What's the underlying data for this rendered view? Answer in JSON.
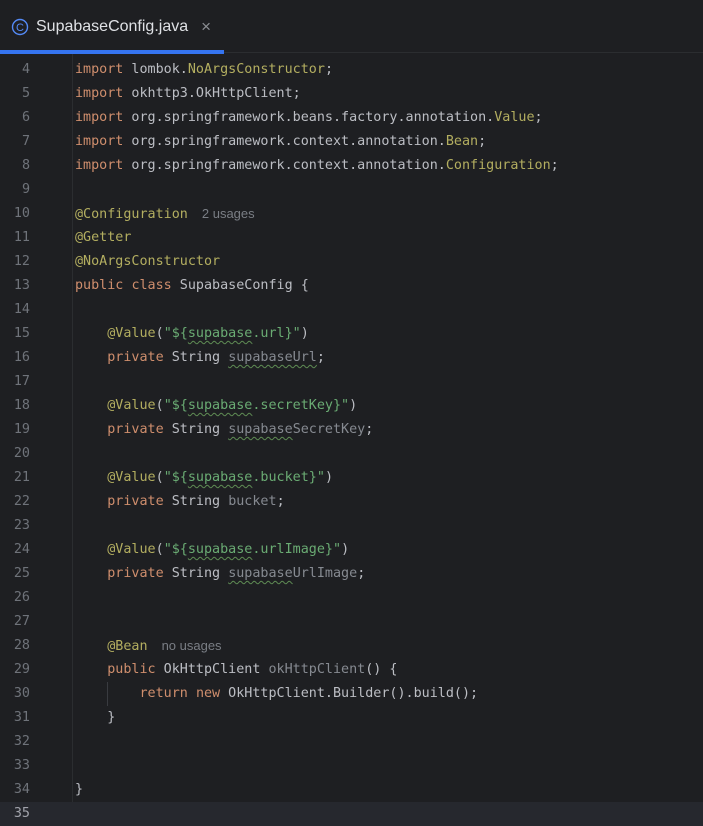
{
  "tab": {
    "filename": "SupabaseConfig.java",
    "close": "×",
    "icon": "java-class-icon",
    "icon_letter": "C"
  },
  "colors": {
    "background": "#1e1f22",
    "keyword": "#cf8e6d",
    "annotation": "#b3ae60",
    "string": "#6aab73",
    "text": "#bcbec4",
    "accent": "#3574f0"
  },
  "lines": [
    {
      "n": "4",
      "t": [
        {
          "x": "import",
          "c": "kw"
        },
        {
          "x": " lombok."
        },
        {
          "x": "NoArgsConstructor",
          "c": "yl"
        },
        {
          "x": ";"
        }
      ]
    },
    {
      "n": "5",
      "t": [
        {
          "x": "import",
          "c": "kw"
        },
        {
          "x": " okhttp3.OkHttpClient;"
        }
      ]
    },
    {
      "n": "6",
      "t": [
        {
          "x": "import",
          "c": "kw"
        },
        {
          "x": " org.springframework.beans.factory.annotation."
        },
        {
          "x": "Value",
          "c": "yl"
        },
        {
          "x": ";"
        }
      ]
    },
    {
      "n": "7",
      "t": [
        {
          "x": "import",
          "c": "kw"
        },
        {
          "x": " org.springframework.context.annotation."
        },
        {
          "x": "Bean",
          "c": "yl"
        },
        {
          "x": ";"
        }
      ]
    },
    {
      "n": "8",
      "t": [
        {
          "x": "import",
          "c": "kw"
        },
        {
          "x": " org.springframework.context.annotation."
        },
        {
          "x": "Configuration",
          "c": "yl"
        },
        {
          "x": ";"
        }
      ]
    },
    {
      "n": "9",
      "t": []
    },
    {
      "n": "10",
      "t": [
        {
          "x": "@Configuration",
          "c": "ann"
        },
        {
          "x": "2 usages",
          "c": "hint"
        }
      ]
    },
    {
      "n": "11",
      "t": [
        {
          "x": "@Getter",
          "c": "ann"
        }
      ]
    },
    {
      "n": "12",
      "t": [
        {
          "x": "@NoArgsConstructor",
          "c": "ann"
        }
      ]
    },
    {
      "n": "13",
      "t": [
        {
          "x": "public",
          "c": "kw"
        },
        {
          "x": " "
        },
        {
          "x": "class",
          "c": "kw"
        },
        {
          "x": " SupabaseConfig {"
        }
      ]
    },
    {
      "n": "14",
      "t": []
    },
    {
      "n": "15",
      "t": [
        {
          "x": "    "
        },
        {
          "x": "@Value",
          "c": "ann"
        },
        {
          "x": "("
        },
        {
          "x": "\"${",
          "c": "str"
        },
        {
          "x": "supabase",
          "c": "str typo"
        },
        {
          "x": ".url}\"",
          "c": "str"
        },
        {
          "x": ")"
        }
      ]
    },
    {
      "n": "16",
      "t": [
        {
          "x": "    "
        },
        {
          "x": "private",
          "c": "kw"
        },
        {
          "x": " String "
        },
        {
          "x": "supabaseUrl",
          "c": "dim typo"
        },
        {
          "x": ";"
        }
      ]
    },
    {
      "n": "17",
      "t": []
    },
    {
      "n": "18",
      "t": [
        {
          "x": "    "
        },
        {
          "x": "@Value",
          "c": "ann"
        },
        {
          "x": "("
        },
        {
          "x": "\"${",
          "c": "str"
        },
        {
          "x": "supabase",
          "c": "str typo"
        },
        {
          "x": ".secretKey}\"",
          "c": "str"
        },
        {
          "x": ")"
        }
      ]
    },
    {
      "n": "19",
      "t": [
        {
          "x": "    "
        },
        {
          "x": "private",
          "c": "kw"
        },
        {
          "x": " String "
        },
        {
          "x": "supabase",
          "c": "dim typo"
        },
        {
          "x": "SecretKey",
          "c": "dim"
        },
        {
          "x": ";"
        }
      ]
    },
    {
      "n": "20",
      "t": []
    },
    {
      "n": "21",
      "t": [
        {
          "x": "    "
        },
        {
          "x": "@Value",
          "c": "ann"
        },
        {
          "x": "("
        },
        {
          "x": "\"${",
          "c": "str"
        },
        {
          "x": "supabase",
          "c": "str typo"
        },
        {
          "x": ".bucket}\"",
          "c": "str"
        },
        {
          "x": ")"
        }
      ]
    },
    {
      "n": "22",
      "t": [
        {
          "x": "    "
        },
        {
          "x": "private",
          "c": "kw"
        },
        {
          "x": " String "
        },
        {
          "x": "bucket",
          "c": "dim"
        },
        {
          "x": ";"
        }
      ]
    },
    {
      "n": "23",
      "t": []
    },
    {
      "n": "24",
      "t": [
        {
          "x": "    "
        },
        {
          "x": "@Value",
          "c": "ann"
        },
        {
          "x": "("
        },
        {
          "x": "\"${",
          "c": "str"
        },
        {
          "x": "supabase",
          "c": "str typo"
        },
        {
          "x": ".urlImage}\"",
          "c": "str"
        },
        {
          "x": ")"
        }
      ]
    },
    {
      "n": "25",
      "t": [
        {
          "x": "    "
        },
        {
          "x": "private",
          "c": "kw"
        },
        {
          "x": " String "
        },
        {
          "x": "supabase",
          "c": "dim typo"
        },
        {
          "x": "UrlImage",
          "c": "dim"
        },
        {
          "x": ";"
        }
      ]
    },
    {
      "n": "26",
      "t": []
    },
    {
      "n": "27",
      "t": []
    },
    {
      "n": "28",
      "t": [
        {
          "x": "    "
        },
        {
          "x": "@Bean",
          "c": "ann"
        },
        {
          "x": "no usages",
          "c": "hint"
        }
      ]
    },
    {
      "n": "29",
      "t": [
        {
          "x": "    "
        },
        {
          "x": "public",
          "c": "kw"
        },
        {
          "x": " OkHttpClient "
        },
        {
          "x": "okHttpClient",
          "c": "dim"
        },
        {
          "x": "() {"
        }
      ]
    },
    {
      "n": "30",
      "t": [
        {
          "x": "        "
        },
        {
          "x": "return",
          "c": "kw"
        },
        {
          "x": " "
        },
        {
          "x": "new",
          "c": "kw"
        },
        {
          "x": " OkHttpClient.Builder().build();"
        }
      ],
      "guide": true
    },
    {
      "n": "31",
      "t": [
        {
          "x": "    }"
        }
      ]
    },
    {
      "n": "32",
      "t": []
    },
    {
      "n": "33",
      "t": []
    },
    {
      "n": "34",
      "t": [
        {
          "x": "}"
        }
      ]
    },
    {
      "n": "35",
      "t": [],
      "current": true
    }
  ]
}
